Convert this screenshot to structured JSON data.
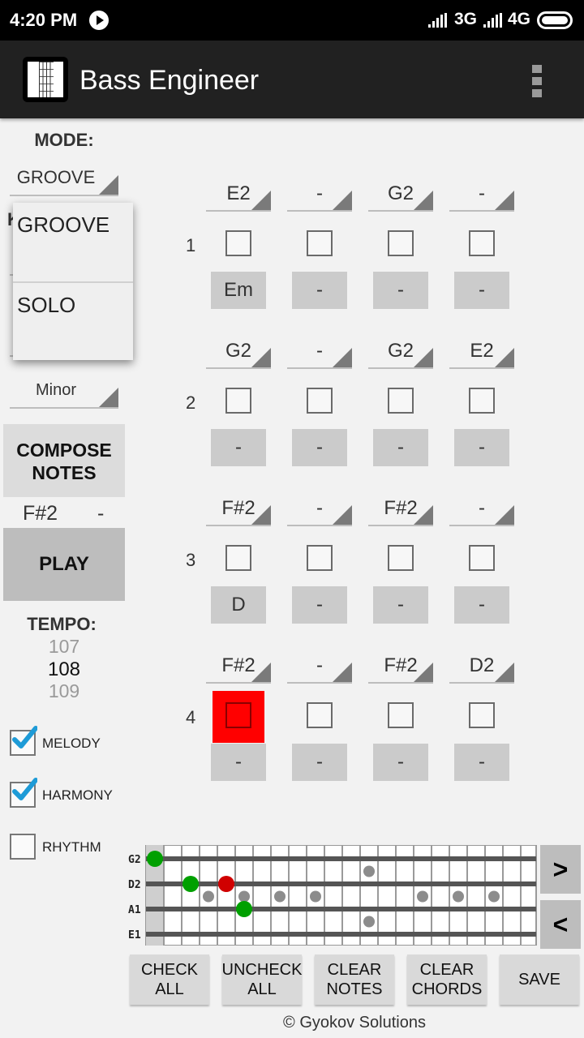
{
  "status_bar": {
    "time": "4:20 PM",
    "network1": "3G",
    "network2": "4G"
  },
  "action_bar": {
    "title": "Bass Engineer",
    "icon": "fretboard-icon",
    "menu_icon": "overflow-menu-icon"
  },
  "left_panel": {
    "mode_label": "MODE:",
    "mode_value": "GROOVE",
    "hidden_label_fragment": "K",
    "scale_value": "Minor",
    "compose_button": "COMPOSE\nNOTES",
    "compose_line1": "COMPOSE",
    "compose_line2": "NOTES",
    "current_note": "F#2",
    "current_chord": "-",
    "play_button": "PLAY",
    "tempo_label": "TEMPO:",
    "tempo_prev": "107",
    "tempo_value": "108",
    "tempo_next": "109",
    "checkboxes": [
      {
        "label": "MELODY",
        "checked": true
      },
      {
        "label": "HARMONY",
        "checked": true
      },
      {
        "label": "RHYTHM",
        "checked": false
      }
    ]
  },
  "mode_dropdown": {
    "open": true,
    "options": [
      "GROOVE",
      "SOLO"
    ]
  },
  "measures": [
    {
      "number": "1",
      "notes": [
        "E2",
        "-",
        "G2",
        "-"
      ],
      "checked": [
        false,
        false,
        false,
        false
      ],
      "chords": [
        "Em",
        "-",
        "-",
        "-"
      ]
    },
    {
      "number": "2",
      "notes": [
        "G2",
        "-",
        "G2",
        "E2"
      ],
      "checked": [
        false,
        false,
        false,
        false
      ],
      "chords": [
        "-",
        "-",
        "-",
        "-"
      ]
    },
    {
      "number": "3",
      "notes": [
        "F#2",
        "-",
        "F#2",
        "-"
      ],
      "checked": [
        false,
        false,
        false,
        false
      ],
      "chords": [
        "D",
        "-",
        "-",
        "-"
      ]
    },
    {
      "number": "4",
      "notes": [
        "F#2",
        "-",
        "F#2",
        "D2"
      ],
      "checked": [
        false,
        false,
        false,
        false
      ],
      "chords": [
        "-",
        "-",
        "-",
        "-"
      ],
      "playing_beat": 1
    }
  ],
  "fretboard": {
    "strings": [
      "G2",
      "D2",
      "A1",
      "E1"
    ],
    "visible_frets": 21,
    "inlay_frets": [
      3,
      5,
      7,
      9,
      15,
      17,
      19
    ],
    "double_inlay_frets": [
      12
    ],
    "active_notes": [
      {
        "string": "G2",
        "fret": 0,
        "color": "#00a000"
      },
      {
        "string": "D2",
        "fret": 2,
        "color": "#00a000"
      },
      {
        "string": "D2",
        "fret": 4,
        "color": "#d00000"
      },
      {
        "string": "A1",
        "fret": 5,
        "color": "#00a000"
      }
    ],
    "next_label": ">",
    "prev_label": "<"
  },
  "bottom_buttons": [
    {
      "line1": "CHECK",
      "line2": "ALL"
    },
    {
      "line1": "UNCHECK",
      "line2": "ALL"
    },
    {
      "line1": "CLEAR",
      "line2": "NOTES"
    },
    {
      "line1": "CLEAR",
      "line2": "CHORDS"
    },
    {
      "line1": "SAVE",
      "line2": ""
    }
  ],
  "footer": "© Gyokov Solutions",
  "colors": {
    "highlight": "#ff0000",
    "check_accent": "#1e9bd7",
    "note_green": "#00a000",
    "note_red": "#d00000",
    "inlay_gray": "#8c8c8c"
  }
}
